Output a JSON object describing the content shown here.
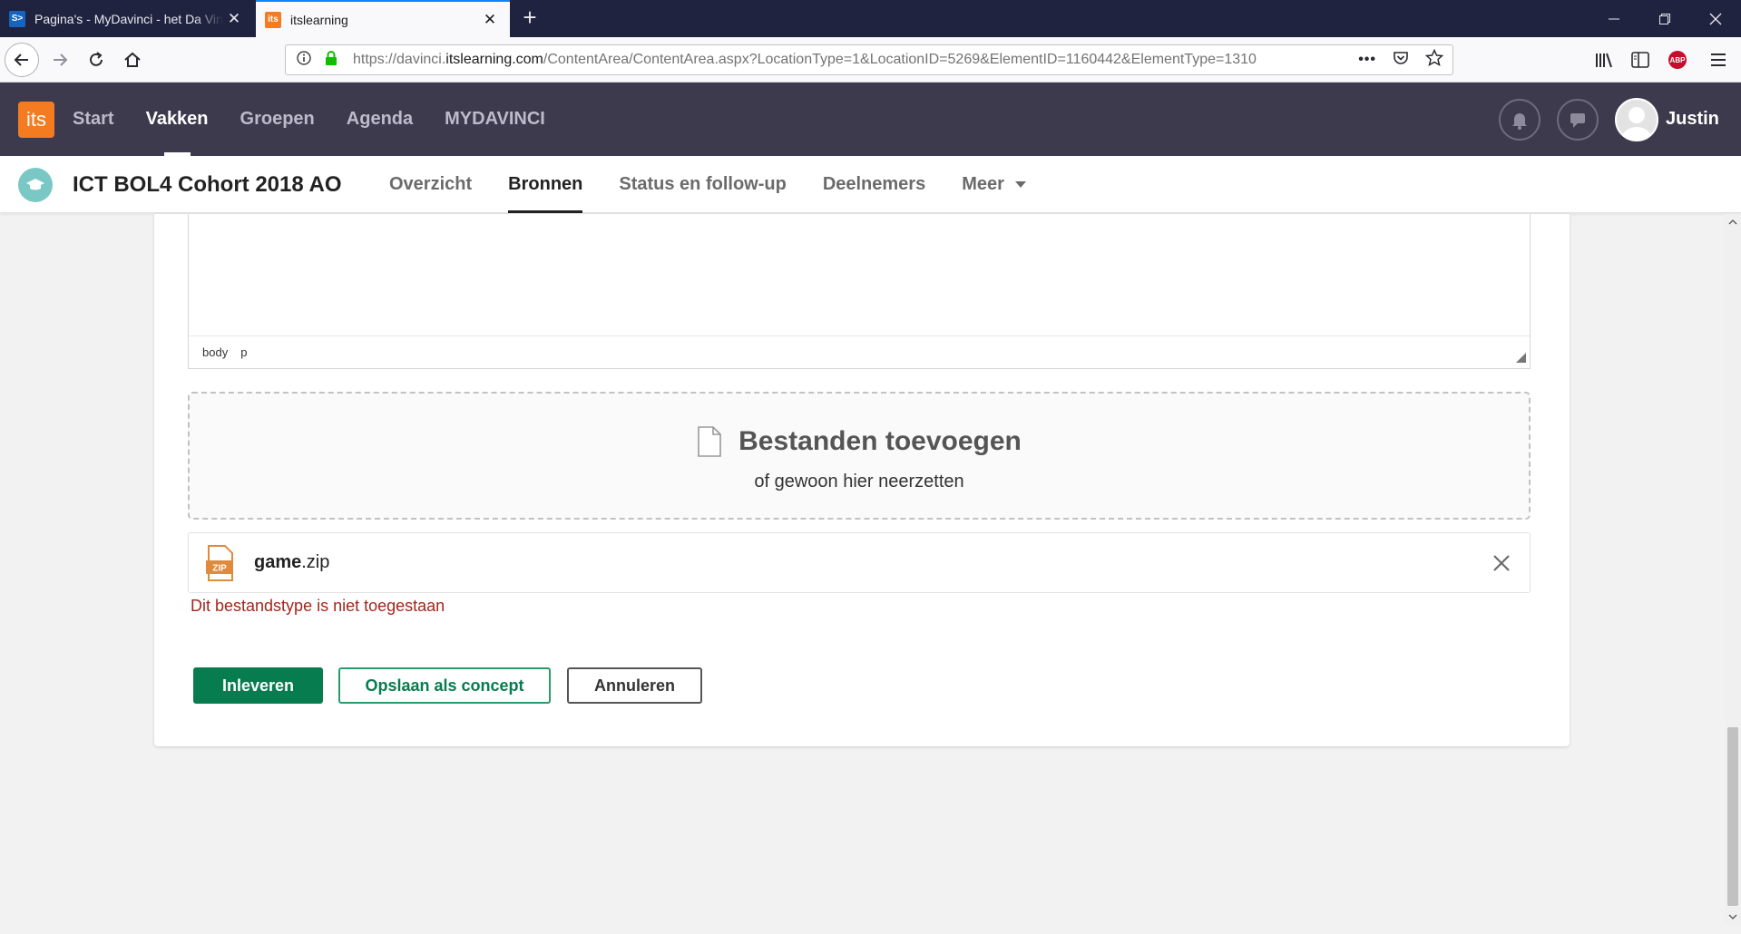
{
  "browser": {
    "tabs": [
      {
        "title": "Pagina's - MyDavinci - het Da Vinci College",
        "favicon_text": "S>",
        "active": false
      },
      {
        "title": "itslearning",
        "favicon_text": "its",
        "active": true
      }
    ],
    "new_tab_symbol": "+",
    "url": {
      "prefix": "https://davinci.",
      "domain": "itslearning.com",
      "path": "/ContentArea/ContentArea.aspx?LocationType=1&LocationID=5269&ElementID=1160442&ElementType=1310"
    },
    "url_more": "•••",
    "abp_label": "ABP"
  },
  "app": {
    "logo_text": "its",
    "nav": [
      {
        "label": "Start",
        "active": false
      },
      {
        "label": "Vakken",
        "active": true
      },
      {
        "label": "Groepen",
        "active": false
      },
      {
        "label": "Agenda",
        "active": false
      },
      {
        "label": "MYDAVINCI",
        "active": false
      }
    ],
    "user_name": "Justin"
  },
  "course": {
    "title": "ICT BOL4 Cohort 2018 AO",
    "tabs": [
      {
        "label": "Overzicht",
        "active": false
      },
      {
        "label": "Bronnen",
        "active": true
      },
      {
        "label": "Status en follow-up",
        "active": false
      },
      {
        "label": "Deelnemers",
        "active": false
      },
      {
        "label": "Meer",
        "active": false
      }
    ]
  },
  "editor": {
    "path": [
      "body",
      "p"
    ]
  },
  "dropzone": {
    "title": "Bestanden toevoegen",
    "subtitle": "of gewoon hier neerzetten"
  },
  "file": {
    "icon_label": "ZIP",
    "name_base": "game",
    "name_ext": ".zip",
    "error": "Dit bestandstype is niet toegestaan"
  },
  "actions": {
    "submit": "Inleveren",
    "save_draft": "Opslaan als concept",
    "cancel": "Annuleren"
  },
  "colors": {
    "brand_orange": "#f47b20",
    "header_bg": "#3e3a4d",
    "primary_green": "#077c4e",
    "error_red": "#a3261d"
  }
}
